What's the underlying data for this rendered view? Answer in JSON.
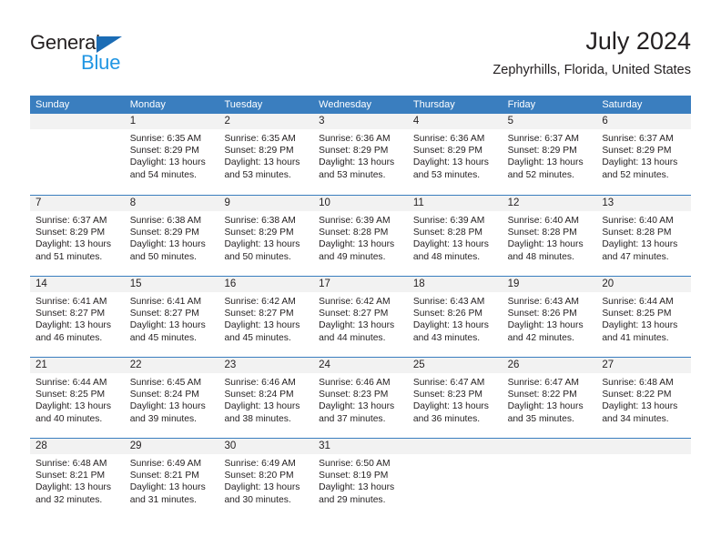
{
  "brand": {
    "name_part1": "General",
    "name_part2": "Blue",
    "triangle_icon": "triangle-icon",
    "accent_color": "#2196e3",
    "triangle_color": "#1b6cb5"
  },
  "header": {
    "title": "July 2024",
    "subtitle": "Zephyrhills, Florida, United States"
  },
  "theme": {
    "header_row_bg": "#3a7ebf",
    "header_row_text": "#ffffff",
    "day_number_bg": "#f2f2f2",
    "row_divider": "#3a7ebf",
    "body_text": "#231f20"
  },
  "weekdays": [
    "Sunday",
    "Monday",
    "Tuesday",
    "Wednesday",
    "Thursday",
    "Friday",
    "Saturday"
  ],
  "weeks": [
    [
      {
        "day": "",
        "empty": true,
        "sunrise": "",
        "sunset": "",
        "daylight_line1": "",
        "daylight_line2": ""
      },
      {
        "day": "1",
        "sunrise": "Sunrise: 6:35 AM",
        "sunset": "Sunset: 8:29 PM",
        "daylight_line1": "Daylight: 13 hours",
        "daylight_line2": "and 54 minutes."
      },
      {
        "day": "2",
        "sunrise": "Sunrise: 6:35 AM",
        "sunset": "Sunset: 8:29 PM",
        "daylight_line1": "Daylight: 13 hours",
        "daylight_line2": "and 53 minutes."
      },
      {
        "day": "3",
        "sunrise": "Sunrise: 6:36 AM",
        "sunset": "Sunset: 8:29 PM",
        "daylight_line1": "Daylight: 13 hours",
        "daylight_line2": "and 53 minutes."
      },
      {
        "day": "4",
        "sunrise": "Sunrise: 6:36 AM",
        "sunset": "Sunset: 8:29 PM",
        "daylight_line1": "Daylight: 13 hours",
        "daylight_line2": "and 53 minutes."
      },
      {
        "day": "5",
        "sunrise": "Sunrise: 6:37 AM",
        "sunset": "Sunset: 8:29 PM",
        "daylight_line1": "Daylight: 13 hours",
        "daylight_line2": "and 52 minutes."
      },
      {
        "day": "6",
        "sunrise": "Sunrise: 6:37 AM",
        "sunset": "Sunset: 8:29 PM",
        "daylight_line1": "Daylight: 13 hours",
        "daylight_line2": "and 52 minutes."
      }
    ],
    [
      {
        "day": "7",
        "sunrise": "Sunrise: 6:37 AM",
        "sunset": "Sunset: 8:29 PM",
        "daylight_line1": "Daylight: 13 hours",
        "daylight_line2": "and 51 minutes."
      },
      {
        "day": "8",
        "sunrise": "Sunrise: 6:38 AM",
        "sunset": "Sunset: 8:29 PM",
        "daylight_line1": "Daylight: 13 hours",
        "daylight_line2": "and 50 minutes."
      },
      {
        "day": "9",
        "sunrise": "Sunrise: 6:38 AM",
        "sunset": "Sunset: 8:29 PM",
        "daylight_line1": "Daylight: 13 hours",
        "daylight_line2": "and 50 minutes."
      },
      {
        "day": "10",
        "sunrise": "Sunrise: 6:39 AM",
        "sunset": "Sunset: 8:28 PM",
        "daylight_line1": "Daylight: 13 hours",
        "daylight_line2": "and 49 minutes."
      },
      {
        "day": "11",
        "sunrise": "Sunrise: 6:39 AM",
        "sunset": "Sunset: 8:28 PM",
        "daylight_line1": "Daylight: 13 hours",
        "daylight_line2": "and 48 minutes."
      },
      {
        "day": "12",
        "sunrise": "Sunrise: 6:40 AM",
        "sunset": "Sunset: 8:28 PM",
        "daylight_line1": "Daylight: 13 hours",
        "daylight_line2": "and 48 minutes."
      },
      {
        "day": "13",
        "sunrise": "Sunrise: 6:40 AM",
        "sunset": "Sunset: 8:28 PM",
        "daylight_line1": "Daylight: 13 hours",
        "daylight_line2": "and 47 minutes."
      }
    ],
    [
      {
        "day": "14",
        "sunrise": "Sunrise: 6:41 AM",
        "sunset": "Sunset: 8:27 PM",
        "daylight_line1": "Daylight: 13 hours",
        "daylight_line2": "and 46 minutes."
      },
      {
        "day": "15",
        "sunrise": "Sunrise: 6:41 AM",
        "sunset": "Sunset: 8:27 PM",
        "daylight_line1": "Daylight: 13 hours",
        "daylight_line2": "and 45 minutes."
      },
      {
        "day": "16",
        "sunrise": "Sunrise: 6:42 AM",
        "sunset": "Sunset: 8:27 PM",
        "daylight_line1": "Daylight: 13 hours",
        "daylight_line2": "and 45 minutes."
      },
      {
        "day": "17",
        "sunrise": "Sunrise: 6:42 AM",
        "sunset": "Sunset: 8:27 PM",
        "daylight_line1": "Daylight: 13 hours",
        "daylight_line2": "and 44 minutes."
      },
      {
        "day": "18",
        "sunrise": "Sunrise: 6:43 AM",
        "sunset": "Sunset: 8:26 PM",
        "daylight_line1": "Daylight: 13 hours",
        "daylight_line2": "and 43 minutes."
      },
      {
        "day": "19",
        "sunrise": "Sunrise: 6:43 AM",
        "sunset": "Sunset: 8:26 PM",
        "daylight_line1": "Daylight: 13 hours",
        "daylight_line2": "and 42 minutes."
      },
      {
        "day": "20",
        "sunrise": "Sunrise: 6:44 AM",
        "sunset": "Sunset: 8:25 PM",
        "daylight_line1": "Daylight: 13 hours",
        "daylight_line2": "and 41 minutes."
      }
    ],
    [
      {
        "day": "21",
        "sunrise": "Sunrise: 6:44 AM",
        "sunset": "Sunset: 8:25 PM",
        "daylight_line1": "Daylight: 13 hours",
        "daylight_line2": "and 40 minutes."
      },
      {
        "day": "22",
        "sunrise": "Sunrise: 6:45 AM",
        "sunset": "Sunset: 8:24 PM",
        "daylight_line1": "Daylight: 13 hours",
        "daylight_line2": "and 39 minutes."
      },
      {
        "day": "23",
        "sunrise": "Sunrise: 6:46 AM",
        "sunset": "Sunset: 8:24 PM",
        "daylight_line1": "Daylight: 13 hours",
        "daylight_line2": "and 38 minutes."
      },
      {
        "day": "24",
        "sunrise": "Sunrise: 6:46 AM",
        "sunset": "Sunset: 8:23 PM",
        "daylight_line1": "Daylight: 13 hours",
        "daylight_line2": "and 37 minutes."
      },
      {
        "day": "25",
        "sunrise": "Sunrise: 6:47 AM",
        "sunset": "Sunset: 8:23 PM",
        "daylight_line1": "Daylight: 13 hours",
        "daylight_line2": "and 36 minutes."
      },
      {
        "day": "26",
        "sunrise": "Sunrise: 6:47 AM",
        "sunset": "Sunset: 8:22 PM",
        "daylight_line1": "Daylight: 13 hours",
        "daylight_line2": "and 35 minutes."
      },
      {
        "day": "27",
        "sunrise": "Sunrise: 6:48 AM",
        "sunset": "Sunset: 8:22 PM",
        "daylight_line1": "Daylight: 13 hours",
        "daylight_line2": "and 34 minutes."
      }
    ],
    [
      {
        "day": "28",
        "sunrise": "Sunrise: 6:48 AM",
        "sunset": "Sunset: 8:21 PM",
        "daylight_line1": "Daylight: 13 hours",
        "daylight_line2": "and 32 minutes."
      },
      {
        "day": "29",
        "sunrise": "Sunrise: 6:49 AM",
        "sunset": "Sunset: 8:21 PM",
        "daylight_line1": "Daylight: 13 hours",
        "daylight_line2": "and 31 minutes."
      },
      {
        "day": "30",
        "sunrise": "Sunrise: 6:49 AM",
        "sunset": "Sunset: 8:20 PM",
        "daylight_line1": "Daylight: 13 hours",
        "daylight_line2": "and 30 minutes."
      },
      {
        "day": "31",
        "sunrise": "Sunrise: 6:50 AM",
        "sunset": "Sunset: 8:19 PM",
        "daylight_line1": "Daylight: 13 hours",
        "daylight_line2": "and 29 minutes."
      },
      {
        "day": "",
        "empty": true,
        "sunrise": "",
        "sunset": "",
        "daylight_line1": "",
        "daylight_line2": ""
      },
      {
        "day": "",
        "empty": true,
        "sunrise": "",
        "sunset": "",
        "daylight_line1": "",
        "daylight_line2": ""
      },
      {
        "day": "",
        "empty": true,
        "sunrise": "",
        "sunset": "",
        "daylight_line1": "",
        "daylight_line2": ""
      }
    ]
  ]
}
